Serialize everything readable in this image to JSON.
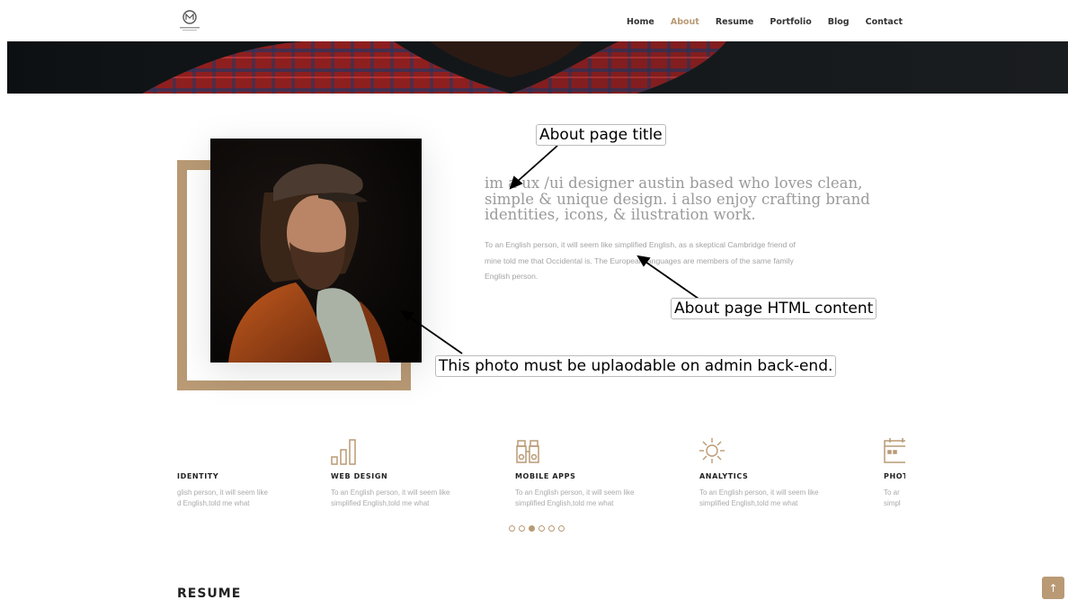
{
  "nav": {
    "items": [
      {
        "label": "Home",
        "active": false
      },
      {
        "label": "About",
        "active": true
      },
      {
        "label": "Resume",
        "active": false
      },
      {
        "label": "Portfolio",
        "active": false
      },
      {
        "label": "Blog",
        "active": false
      },
      {
        "label": "Contact",
        "active": false
      }
    ]
  },
  "about": {
    "title": "im a ux /ui designer austin based who loves clean, simple & unique design. i also enjoy crafting brand identities, icons, & ilustration work.",
    "body": "To an English person, it will seem like simplified English, as a skeptical Cambridge friend of mine told me that Occidental is. The European languages are members of the same family English person."
  },
  "annotations": {
    "title": "About page title",
    "content": "About page HTML content",
    "photo": "This photo must be uplaodable on admin back-end."
  },
  "services": [
    {
      "icon": "identity-icon",
      "title": "IDENTITY",
      "desc_line1": "glish person, it will seem like",
      "desc_line2": "d English,told me what"
    },
    {
      "icon": "bar-chart-icon",
      "title": "WEB DESIGN",
      "desc_line1": "To an English person, it will seem like",
      "desc_line2": "simplified English,told me what"
    },
    {
      "icon": "binoculars-icon",
      "title": "MOBILE APPS",
      "desc_line1": "To an English person, it will seem like",
      "desc_line2": "simplified English,told me what"
    },
    {
      "icon": "sun-icon",
      "title": "ANALYTICS",
      "desc_line1": "To an English person, it will seem like",
      "desc_line2": "simplified English,told me what"
    },
    {
      "icon": "calendar-icon",
      "title": "PHOT",
      "desc_line1": "To ar",
      "desc_line2": "simpl"
    }
  ],
  "carousel": {
    "active_dot": 3,
    "dot_count": 6
  },
  "resume": {
    "heading": "RESUME"
  },
  "colors": {
    "accent": "#b99a75",
    "text": "#333333",
    "muted": "#a3a3a3"
  }
}
